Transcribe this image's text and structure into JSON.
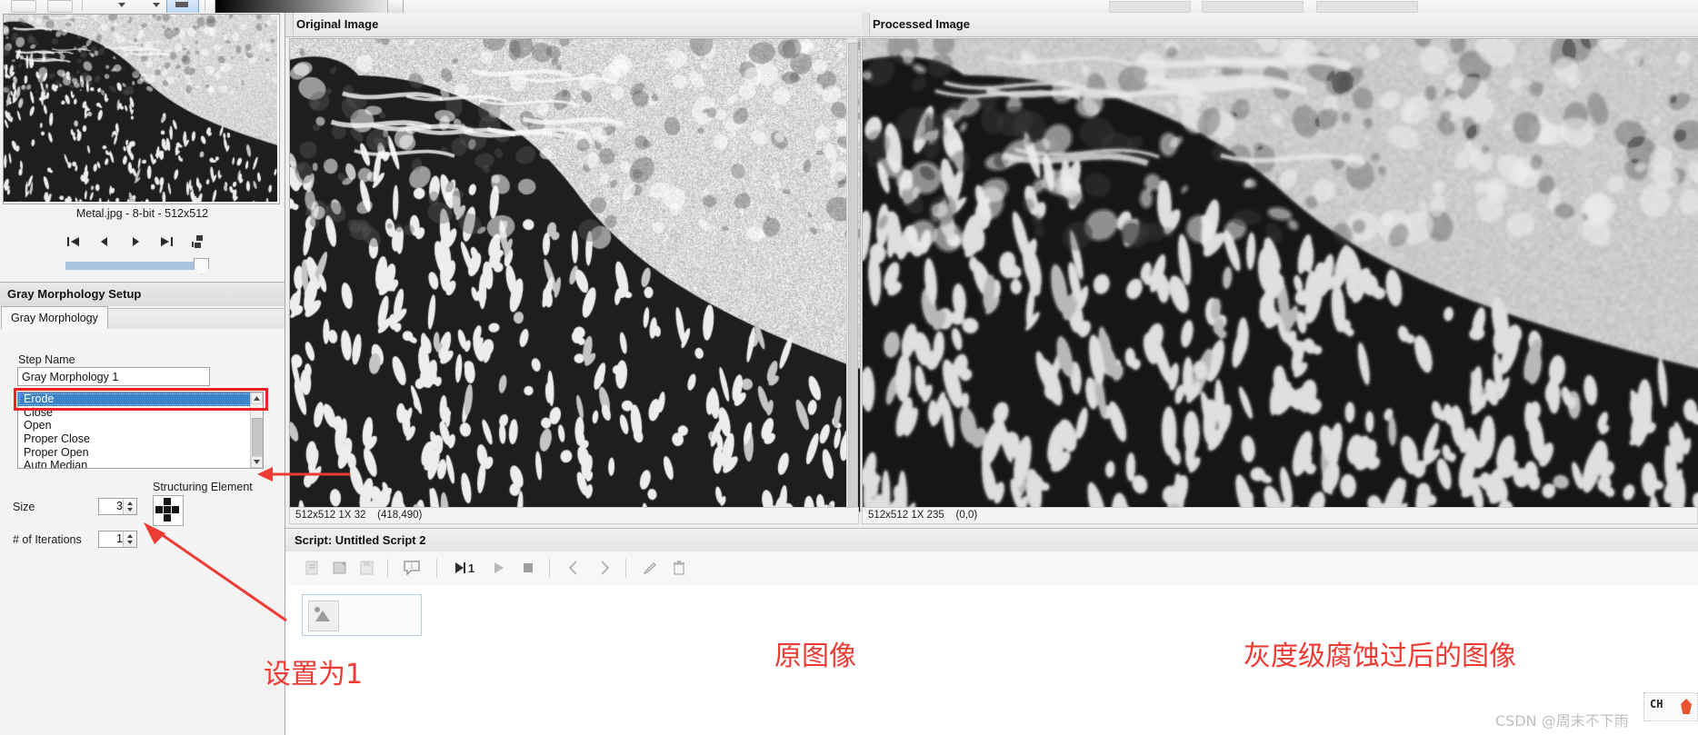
{
  "app": {
    "left_panel": {
      "thumbnail_label": "Metal.jpg - 8-bit - 512x512",
      "nav": [
        {
          "name": "first",
          "glyph": "first-frame-icon"
        },
        {
          "name": "previous",
          "glyph": "previous-frame-icon"
        },
        {
          "name": "next",
          "glyph": "next-frame-icon"
        },
        {
          "name": "last",
          "glyph": "last-frame-icon"
        },
        {
          "name": "layout",
          "glyph": "layout-icon"
        }
      ],
      "setup_title": "Gray Morphology Setup",
      "tab_label": "Gray Morphology",
      "step_name_label": "Step Name",
      "step_name_value": "Gray Morphology 1",
      "operation_options": [
        "Erode",
        "Close",
        "Open",
        "Proper Close",
        "Proper Open",
        "Auto Median"
      ],
      "operation_selected": "Erode",
      "size_label": "Size",
      "size_value": "3",
      "iterations_label": "# of Iterations",
      "iterations_value": "1",
      "structuring_element_label": "Structuring Element"
    },
    "views": {
      "original_title": "Original Image",
      "processed_title": "Processed Image",
      "original_status": "512x512 1X 32    (418,490)",
      "processed_status": "512x512 1X 235    (0,0)"
    },
    "script": {
      "title": "Script: Untitled Script 2",
      "toolbar": [
        {
          "name": "new-script-icon",
          "label": ""
        },
        {
          "name": "open-script-icon",
          "label": ""
        },
        {
          "name": "save-script-icon",
          "label": ""
        },
        {
          "name": "info-icon",
          "label": ""
        },
        {
          "name": "run-once-icon",
          "label": "1"
        },
        {
          "name": "run-icon",
          "label": ""
        },
        {
          "name": "stop-icon",
          "label": ""
        },
        {
          "name": "step-back-icon",
          "label": ""
        },
        {
          "name": "step-forward-icon",
          "label": ""
        },
        {
          "name": "edit-icon",
          "label": ""
        },
        {
          "name": "delete-icon",
          "label": ""
        }
      ]
    },
    "annotations": {
      "set_to_one": "设置为1",
      "original_image_cn": "原图像",
      "processed_image_cn": "灰度级腐蚀过后的图像"
    },
    "watermark": "CSDN @周末不下雨",
    "ime": {
      "mode": "CH"
    },
    "colors": {
      "annotation_red": "#ee3b33",
      "selection_blue": "#3c84c6",
      "panel_gray": "#f4f4f4"
    }
  }
}
